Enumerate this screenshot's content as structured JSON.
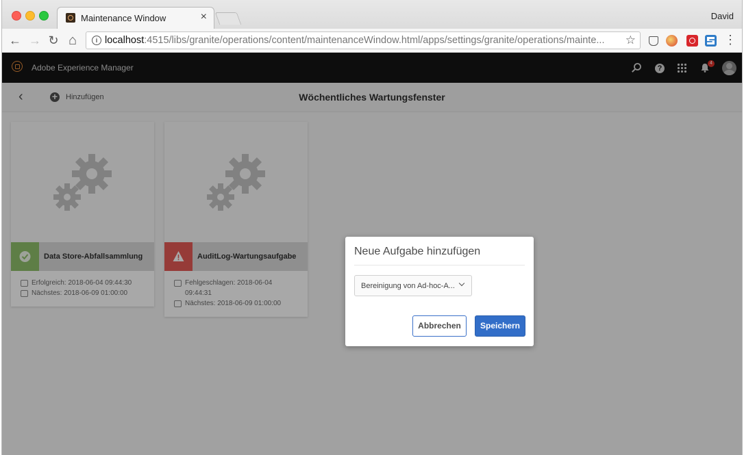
{
  "browser": {
    "tab_title": "Maintenance Window",
    "tab_close": "×",
    "profile_name": "David",
    "url_host": "localhost",
    "url_rest": ":4515/libs/granite/operations/content/maintenanceWindow.html/apps/settings/granite/operations/mainte...",
    "back_glyph": "←",
    "forward_glyph": "→",
    "reload_glyph": "↻",
    "home_glyph": "⌂",
    "star_glyph": "☆",
    "menu_glyph": "⋮"
  },
  "shell": {
    "brand": "Adobe Experience Manager",
    "search_glyph": "⚲",
    "help_glyph": "?",
    "notification_count": "4"
  },
  "actionbar": {
    "back_glyph": "‹",
    "add_glyph": "+",
    "add_label": "Hinzufügen",
    "title": "Wöchentliches Wartungsfenster"
  },
  "cards": [
    {
      "name": "Data Store-Abfallsammlung",
      "status": "success",
      "status_color": "#8fbf6b",
      "meta": [
        "Erfolgreich: 2018-06-04 09:44:30",
        "Nächstes: 2018-06-09 01:00:00"
      ]
    },
    {
      "name": "AuditLog-Wartungsaufgabe",
      "status": "failed",
      "status_color": "#e45a55",
      "meta": [
        "Fehlgeschlagen: 2018-06-04 09:44:31",
        "Nächstes: 2018-06-09 01:00:00"
      ]
    }
  ],
  "dialog": {
    "title": "Neue Aufgabe hinzufügen",
    "select_value": "Bereinigung von Ad-hoc-A...",
    "cancel_label": "Abbrechen",
    "save_label": "Speichern",
    "accent_color": "#326ec8"
  }
}
